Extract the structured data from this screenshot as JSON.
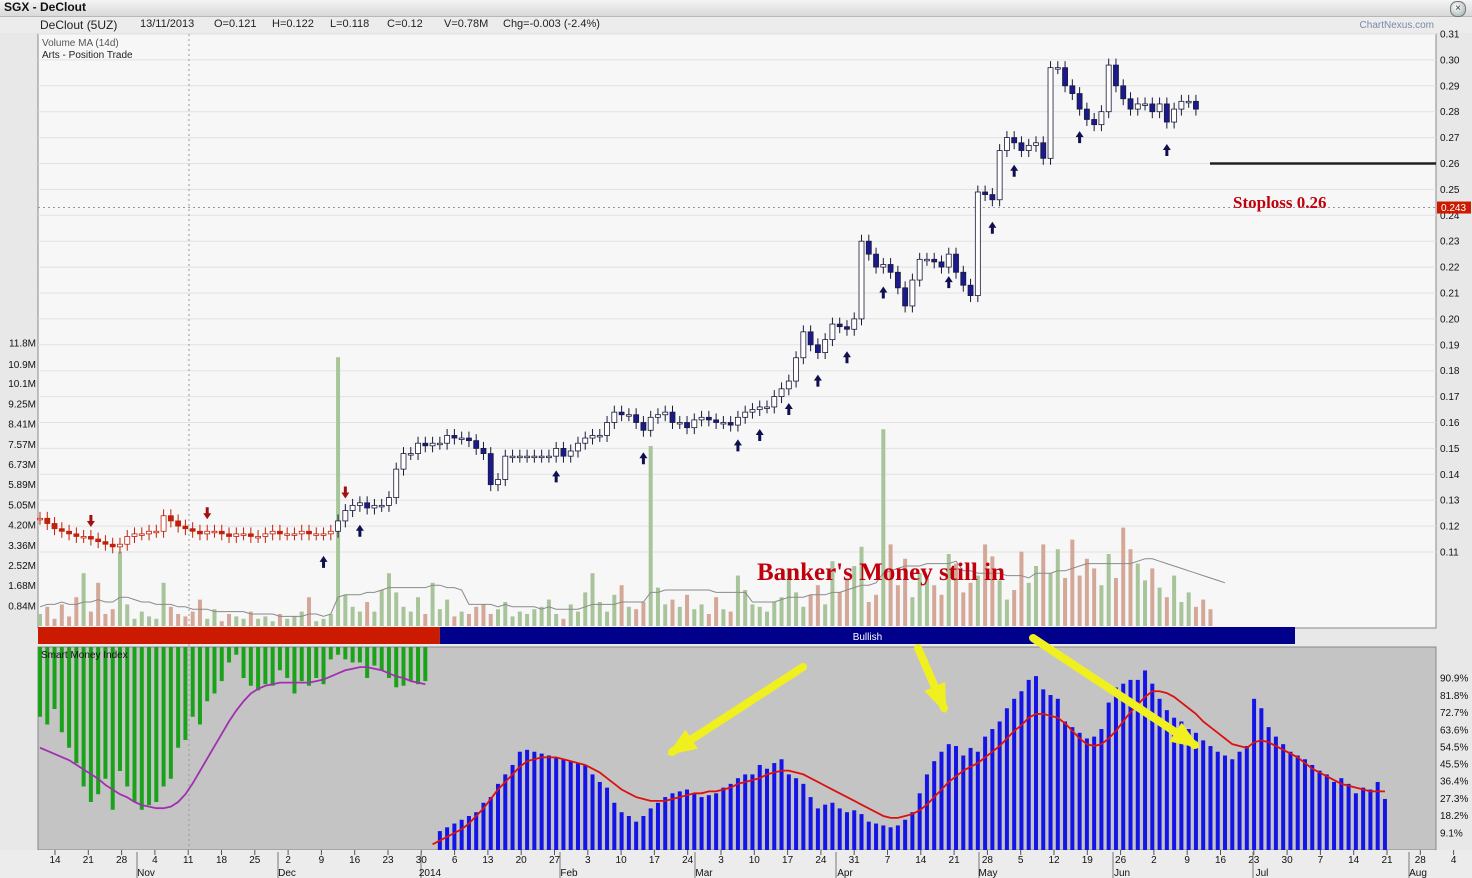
{
  "window": {
    "title": "SGX - DeClout",
    "close_glyph": "×"
  },
  "header": {
    "name": "DeClout (5UZ)",
    "date": "13/11/2013",
    "open": "O=0.121",
    "high": "H=0.122",
    "low": "L=0.118",
    "close": "C=0.12",
    "volume": "V=0.78M",
    "change": "Chg=-0.003 (-2.4%)",
    "brand": "ChartNexus.com"
  },
  "legend": {
    "volume_ma": "Volume MA (14d)",
    "strategy": "Arts - Position Trade",
    "smi": "Smart Money Index"
  },
  "annotations": {
    "stoploss": "Stoploss 0.26",
    "banker": "Banker's Money still in"
  },
  "trend_band": {
    "label": "Bullish",
    "bearish_color": "#cc1a00",
    "bullish_color": "#00008b"
  },
  "colors": {
    "up_candle": "#ffffff",
    "down_candle": "#1a1a8c",
    "early_candle": "#c0200c",
    "vol_up": "#a8c49a",
    "vol_down": "#d4a898",
    "smi_blue": "#1414e6",
    "smi_green": "#1aa31a",
    "smi_line": "#dd1010",
    "ma_line": "#a030b0",
    "arrow": "#f0f020"
  },
  "chart_data": [
    {
      "type": "candlestick",
      "title": "DeClout (5UZ)",
      "price_axis_ticks": [
        "0.31",
        "0.30",
        "0.29",
        "0.28",
        "0.27",
        "0.26",
        "0.25",
        "0.24",
        "0.23",
        "0.22",
        "0.21",
        "0.20",
        "0.19",
        "0.18",
        "0.17",
        "0.16",
        "0.15",
        "0.14",
        "0.13",
        "0.12",
        "0.11"
      ],
      "last_price_marker": "0.243",
      "stoploss_level": 0.26,
      "x_ticks": [
        "14",
        "21",
        "28",
        "4",
        "11",
        "18",
        "25",
        "2",
        "9",
        "16",
        "23",
        "30",
        "6",
        "13",
        "20",
        "27",
        "3",
        "10",
        "17",
        "24",
        "3",
        "10",
        "17",
        "24",
        "31",
        "7",
        "14",
        "21",
        "28",
        "5",
        "12",
        "19",
        "26",
        "2",
        "9",
        "16",
        "23",
        "30",
        "7",
        "14",
        "21",
        "28",
        "4"
      ],
      "month_labels": [
        "Nov",
        "Dec",
        "2014",
        "Feb",
        "Mar",
        "Apr",
        "May",
        "Jun",
        "Jul",
        "Aug"
      ],
      "closes": [
        0.123,
        0.121,
        0.119,
        0.118,
        0.117,
        0.116,
        0.116,
        0.115,
        0.114,
        0.113,
        0.112,
        0.113,
        0.116,
        0.117,
        0.117,
        0.118,
        0.118,
        0.124,
        0.122,
        0.12,
        0.119,
        0.118,
        0.117,
        0.118,
        0.118,
        0.117,
        0.116,
        0.117,
        0.117,
        0.116,
        0.116,
        0.117,
        0.118,
        0.117,
        0.117,
        0.117,
        0.118,
        0.117,
        0.117,
        0.117,
        0.118,
        0.122,
        0.126,
        0.128,
        0.129,
        0.127,
        0.128,
        0.128,
        0.131,
        0.142,
        0.148,
        0.148,
        0.152,
        0.151,
        0.152,
        0.152,
        0.155,
        0.154,
        0.154,
        0.153,
        0.15,
        0.148,
        0.136,
        0.138,
        0.147,
        0.147,
        0.147,
        0.147,
        0.147,
        0.147,
        0.147,
        0.15,
        0.147,
        0.149,
        0.152,
        0.154,
        0.155,
        0.155,
        0.16,
        0.164,
        0.163,
        0.163,
        0.16,
        0.157,
        0.162,
        0.163,
        0.164,
        0.16,
        0.16,
        0.158,
        0.161,
        0.162,
        0.161,
        0.16,
        0.16,
        0.159,
        0.162,
        0.164,
        0.165,
        0.166,
        0.166,
        0.17,
        0.173,
        0.176,
        0.185,
        0.195,
        0.19,
        0.187,
        0.192,
        0.198,
        0.197,
        0.196,
        0.2,
        0.23,
        0.225,
        0.22,
        0.221,
        0.218,
        0.212,
        0.205,
        0.215,
        0.223,
        0.223,
        0.222,
        0.22,
        0.225,
        0.218,
        0.213,
        0.209,
        0.249,
        0.248,
        0.246,
        0.265,
        0.27,
        0.268,
        0.265,
        0.267,
        0.268,
        0.262,
        0.297,
        0.297,
        0.29,
        0.287,
        0.281,
        0.277,
        0.275,
        0.28,
        0.298,
        0.29,
        0.285,
        0.281,
        0.283,
        0.283,
        0.28,
        0.283,
        0.276,
        0.281,
        0.284,
        0.284,
        0.281
      ],
      "volume_axis_ticks": [
        "11.8M",
        "10.9M",
        "10.1M",
        "9.25M",
        "8.41M",
        "7.57M",
        "6.73M",
        "5.89M",
        "5.05M",
        "4.20M",
        "3.36M",
        "2.52M",
        "1.68M",
        "0.84M"
      ],
      "volumes_m": [
        0.5,
        0.8,
        0.3,
        0.9,
        0.4,
        1.2,
        2.2,
        0.6,
        1.8,
        0.5,
        0.7,
        3.1,
        0.9,
        0.3,
        0.6,
        0.4,
        0.3,
        1.8,
        0.8,
        0.5,
        0.4,
        0.6,
        1.1,
        0.3,
        0.7,
        0.2,
        0.5,
        0.4,
        0.3,
        0.6,
        0.3,
        0.4,
        0.2,
        0.5,
        0.3,
        0.4,
        0.6,
        1.2,
        0.2,
        0.3,
        0.5,
        11.2,
        1.3,
        0.8,
        0.6,
        1.0,
        0.6,
        1.5,
        2.2,
        1.4,
        0.8,
        0.6,
        1.2,
        0.5,
        1.8,
        0.7,
        1.1,
        0.4,
        0.6,
        0.5,
        0.8,
        0.9,
        0.5,
        0.7,
        1.0,
        0.4,
        0.6,
        0.5,
        0.7,
        0.8,
        1.1,
        0.5,
        0.3,
        0.9,
        0.6,
        1.4,
        2.2,
        1.0,
        0.6,
        1.3,
        1.7,
        0.8,
        0.7,
        1.0,
        7.5,
        1.6,
        0.9,
        1.1,
        0.8,
        1.3,
        0.7,
        0.9,
        0.5,
        1.2,
        0.7,
        0.6,
        2.1,
        1.5,
        0.9,
        0.8,
        0.6,
        1.0,
        1.2,
        2.4,
        1.4,
        0.8,
        1.3,
        1.7,
        0.9,
        2.7,
        1.4,
        2.0,
        2.5,
        3.3,
        1.0,
        1.3,
        8.2,
        3.4,
        1.7,
        2.8,
        1.2,
        2.2,
        2.0,
        1.7,
        1.3,
        3.0,
        2.6,
        1.4,
        1.8,
        2.1,
        3.4,
        2.9,
        1.9,
        1.1,
        1.5,
        3.1,
        1.8,
        2.5,
        3.4,
        2.2,
        3.2,
        2.0,
        3.6,
        2.1,
        2.8,
        2.4,
        1.7,
        3.0,
        2.0,
        4.1,
        3.2,
        2.6,
        1.9,
        2.4,
        1.6,
        1.2,
        2.1,
        1.0,
        1.4,
        0.8,
        1.1,
        0.7
      ],
      "volume_ma_m": [
        0.8,
        0.9,
        0.9,
        1.0,
        0.9,
        0.9,
        1.0,
        1.0,
        1.1,
        1.0,
        1.0,
        1.2,
        1.2,
        1.1,
        1.0,
        1.0,
        0.9,
        0.9,
        0.9,
        0.8,
        0.8,
        0.7,
        0.7,
        0.7,
        0.6,
        0.6,
        0.6,
        0.6,
        0.6,
        0.5,
        0.5,
        0.5,
        0.5,
        0.4,
        0.4,
        0.4,
        0.4,
        0.5,
        0.5,
        0.4,
        0.5,
        1.2,
        1.3,
        1.3,
        1.3,
        1.4,
        1.4,
        1.5,
        1.6,
        1.6,
        1.6,
        1.6,
        1.6,
        1.6,
        1.7,
        1.7,
        1.6,
        1.6,
        1.5,
        0.9,
        0.9,
        0.9,
        0.9,
        0.8,
        0.9,
        0.8,
        0.8,
        0.8,
        0.8,
        0.7,
        0.8,
        0.7,
        0.7,
        0.7,
        0.7,
        0.8,
        0.9,
        0.9,
        0.9,
        0.9,
        1.0,
        1.0,
        1.0,
        1.0,
        1.4,
        1.4,
        1.5,
        1.5,
        1.5,
        1.5,
        1.5,
        1.5,
        1.5,
        1.4,
        1.4,
        1.4,
        1.4,
        1.4,
        1.0,
        1.0,
        1.0,
        1.0,
        1.1,
        1.2,
        1.2,
        1.2,
        1.3,
        1.3,
        1.3,
        1.4,
        1.4,
        1.5,
        1.6,
        1.7,
        1.7,
        1.8,
        2.2,
        2.3,
        2.4,
        2.5,
        2.5,
        2.5,
        2.6,
        2.6,
        2.6,
        2.6,
        2.7,
        2.3,
        2.3,
        2.2,
        2.2,
        2.2,
        2.2,
        2.1,
        2.1,
        2.1,
        2.0,
        2.2,
        2.2,
        2.2,
        2.3,
        2.3,
        2.4,
        2.5,
        2.6,
        2.6,
        2.6,
        2.6,
        2.6,
        2.6,
        2.6,
        2.7,
        2.8,
        2.8,
        2.7,
        2.6,
        2.5,
        2.4,
        2.3,
        2.2,
        2.1,
        2.0,
        1.9,
        1.8
      ],
      "buy_signal_indices": [
        39,
        44,
        71,
        83,
        96,
        99,
        103,
        107,
        111,
        116,
        125,
        131,
        134,
        143,
        155,
        172
      ],
      "sell_signal_indices": [
        7,
        23,
        42
      ],
      "trend_change_index": 55
    },
    {
      "type": "bar",
      "title": "Smart Money Index",
      "y_axis_ticks": [
        "90.9%",
        "81.8%",
        "72.7%",
        "63.6%",
        "54.5%",
        "45.5%",
        "36.4%",
        "27.3%",
        "18.2%",
        "9.1%"
      ],
      "ylim": [
        0,
        100
      ],
      "smi_values": [
        75,
        70,
        80,
        65,
        55,
        45,
        30,
        20,
        25,
        35,
        15,
        40,
        30,
        20,
        15,
        18,
        20,
        30,
        35,
        55,
        60,
        75,
        70,
        85,
        90,
        98,
        110,
        115,
        100,
        95,
        92,
        96,
        95,
        105,
        100,
        90,
        98,
        95,
        100,
        96,
        112,
        115,
        112,
        110,
        110,
        100,
        108,
        105,
        100,
        94,
        95,
        98,
        96,
        98,
        0,
        10,
        12,
        14,
        16,
        18,
        20,
        25,
        28,
        35,
        40,
        45,
        52,
        53,
        52,
        51,
        50,
        49,
        48,
        47,
        46,
        45,
        40,
        36,
        33,
        25,
        20,
        18,
        15,
        18,
        22,
        25,
        28,
        30,
        31,
        32,
        30,
        28,
        29,
        30,
        33,
        35,
        38,
        40,
        40,
        45,
        43,
        46,
        48,
        40,
        38,
        35,
        28,
        22,
        24,
        25,
        22,
        20,
        21,
        19,
        15,
        14,
        13,
        12,
        13,
        16,
        20,
        30,
        40,
        47,
        52,
        56,
        55,
        50,
        54,
        52,
        60,
        64,
        68,
        75,
        80,
        84,
        90,
        92,
        85,
        82,
        80,
        68,
        65,
        62,
        59,
        60,
        64,
        78,
        86,
        88,
        90,
        90,
        95,
        88,
        80,
        74,
        70,
        68,
        64,
        62,
        58,
        55,
        52,
        50,
        48,
        52,
        55,
        80,
        75,
        65,
        60,
        56,
        52,
        50,
        48,
        45,
        42,
        40,
        36,
        38,
        35,
        30,
        33,
        32,
        36,
        27
      ],
      "smi_ma": [
        55,
        53,
        51,
        49,
        47,
        44,
        41,
        38,
        35,
        31,
        28,
        25,
        23,
        20,
        18,
        17,
        16,
        16,
        17,
        20,
        25,
        32,
        40,
        48,
        56,
        64,
        72,
        79,
        85,
        90,
        93,
        95,
        96,
        97,
        97,
        97,
        97,
        97,
        98,
        99,
        101,
        103,
        105,
        106,
        107,
        107,
        106,
        105,
        103,
        101,
        100,
        98,
        97,
        96,
        3,
        5,
        7,
        9,
        11,
        14,
        18,
        22,
        27,
        32,
        36,
        40,
        44,
        47,
        48,
        49,
        49,
        49,
        48,
        47,
        46,
        45,
        43,
        41,
        38,
        35,
        32,
        30,
        28,
        27,
        26,
        26,
        26,
        27,
        28,
        29,
        30,
        30,
        31,
        31,
        32,
        33,
        35,
        36,
        37,
        38,
        40,
        41,
        42,
        42,
        41,
        40,
        38,
        36,
        34,
        32,
        30,
        28,
        26,
        24,
        22,
        20,
        18,
        17,
        17,
        18,
        19,
        21,
        24,
        28,
        32,
        36,
        39,
        42,
        44,
        46,
        49,
        52,
        55,
        59,
        63,
        66,
        70,
        72,
        72,
        71,
        70,
        67,
        63,
        59,
        56,
        55,
        56,
        59,
        63,
        68,
        73,
        77,
        81,
        84,
        84,
        83,
        81,
        78,
        75,
        72,
        68,
        65,
        62,
        59,
        56,
        55,
        54,
        57,
        58,
        57,
        55,
        53,
        51,
        49,
        46,
        43,
        41,
        39,
        37,
        35,
        34,
        33,
        32,
        31,
        31,
        31
      ]
    }
  ]
}
